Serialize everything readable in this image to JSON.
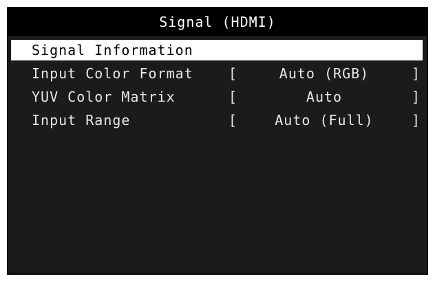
{
  "menu": {
    "title": "Signal (HDMI)",
    "items": [
      {
        "label": "Signal Information"
      },
      {
        "label": "Input Color Format",
        "open": "[",
        "value": "Auto (RGB)",
        "close": "]"
      },
      {
        "label": "YUV Color Matrix",
        "open": "[",
        "value": "Auto",
        "close": "]"
      },
      {
        "label": "Input Range",
        "open": "[",
        "value": "Auto (Full)",
        "close": "]"
      }
    ]
  },
  "colors": {
    "background": "#1b1b1b",
    "title_bar": "#000000",
    "highlight": "#ffffff",
    "text": "#e8e8e8"
  }
}
